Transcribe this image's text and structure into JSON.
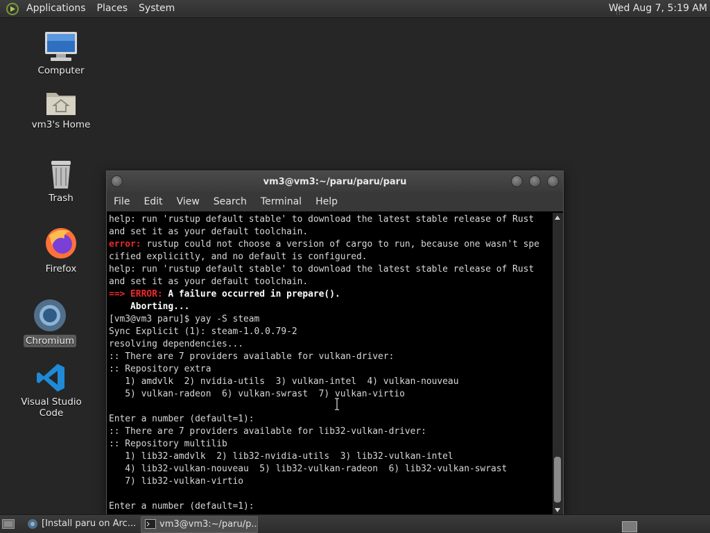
{
  "top_panel": {
    "menu": [
      "Applications",
      "Places",
      "System"
    ],
    "clock": "Wed Aug  7,  5:19 AM"
  },
  "desktop": {
    "icons": [
      {
        "label": "Computer",
        "icon": "computer-icon"
      },
      {
        "label": "vm3's Home",
        "icon": "home-folder-icon"
      },
      {
        "label": "Trash",
        "icon": "trash-icon"
      },
      {
        "label": "Firefox",
        "icon": "firefox-icon"
      },
      {
        "label": "Chromium",
        "icon": "chromium-icon"
      },
      {
        "label": "Visual Studio Code",
        "icon": "vscode-icon"
      }
    ]
  },
  "terminal": {
    "title": "vm3@vm3:~/paru/paru/paru",
    "menu": [
      "File",
      "Edit",
      "View",
      "Search",
      "Terminal",
      "Help"
    ],
    "lines": [
      {
        "text": "help: run 'rustup default stable' to download the latest stable release of Rust"
      },
      {
        "text": "and set it as your default toolchain."
      },
      {
        "prefix": "error:",
        "text": " rustup could not choose a version of cargo to run, because one wasn't spe"
      },
      {
        "text": "cified explicitly, and no default is configured."
      },
      {
        "text": "help: run 'rustup default stable' to download the latest stable release of Rust"
      },
      {
        "text": "and set it as your default toolchain."
      },
      {
        "prefix": "==> ERROR:",
        "bold": " A failure occurred in prepare()."
      },
      {
        "bold": "    Aborting..."
      },
      {
        "text": "[vm3@vm3 paru]$ yay -S steam"
      },
      {
        "text": "Sync Explicit (1): steam-1.0.0.79-2"
      },
      {
        "text": "resolving dependencies..."
      },
      {
        "text": ":: There are 7 providers available for vulkan-driver:"
      },
      {
        "text": ":: Repository extra"
      },
      {
        "text": "   1) amdvlk  2) nvidia-utils  3) vulkan-intel  4) vulkan-nouveau"
      },
      {
        "text": "   5) vulkan-radeon  6) vulkan-swrast  7) vulkan-virtio"
      },
      {
        "text": ""
      },
      {
        "text": "Enter a number (default=1):"
      },
      {
        "text": ":: There are 7 providers available for lib32-vulkan-driver:"
      },
      {
        "text": ":: Repository multilib"
      },
      {
        "text": "   1) lib32-amdvlk  2) lib32-nvidia-utils  3) lib32-vulkan-intel"
      },
      {
        "text": "   4) lib32-vulkan-nouveau  5) lib32-vulkan-radeon  6) lib32-vulkan-swrast"
      },
      {
        "text": "   7) lib32-vulkan-virtio"
      },
      {
        "text": ""
      },
      {
        "text": "Enter a number (default=1):"
      }
    ]
  },
  "taskbar": {
    "tasks": [
      {
        "label": "[Install paru on Arc...",
        "icon": "chromium-icon",
        "active": false
      },
      {
        "label": "vm3@vm3:~/paru/p...",
        "icon": "terminal-icon",
        "active": true
      }
    ]
  },
  "colors": {
    "error": "#ef2929",
    "desktop_bg": "#262626",
    "terminal_bg": "#000000"
  }
}
